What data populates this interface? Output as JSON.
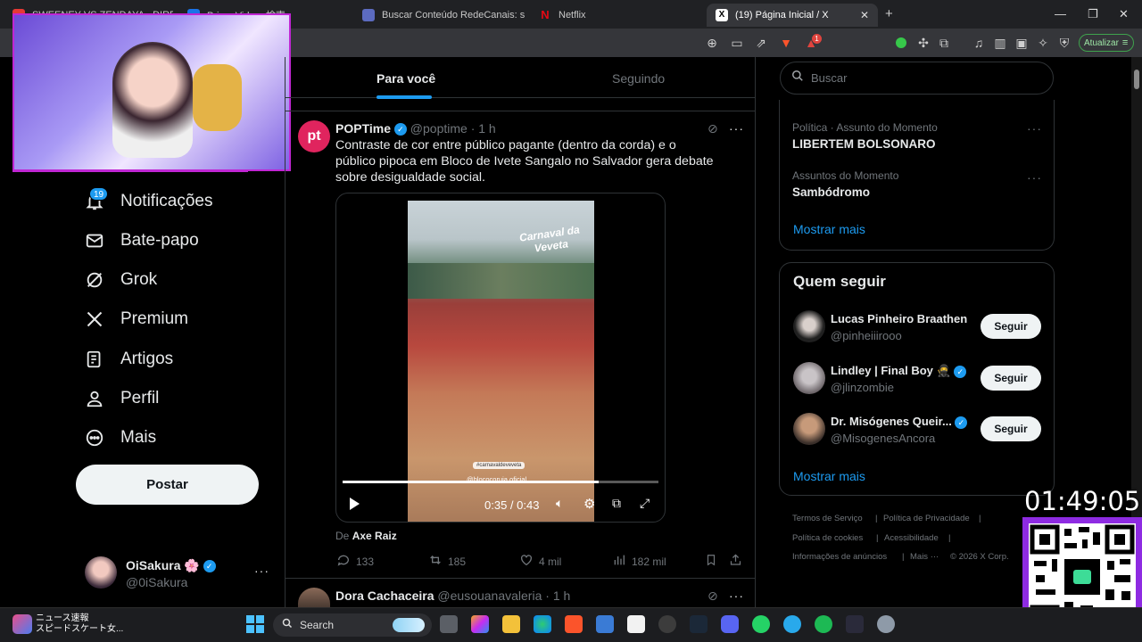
{
  "browser": {
    "tabs": [
      {
        "label": "SWEENEY VS ZENDAYA - DIREITA VS",
        "fav": "#e53935"
      },
      {
        "label": "Prime Video: 検索",
        "fav": "#1a73e8"
      },
      {
        "label": "Buscar Conteúdo RedeCanais: star tre",
        "fav": "#5c6bc0"
      },
      {
        "label": "Netflix",
        "fav": "#e50914"
      },
      {
        "label": "(19) Página Inicial / X",
        "fav": "#000000"
      }
    ],
    "update_label": "Atualizar",
    "new_tab": "+",
    "brave_badge": "1"
  },
  "nav": {
    "notifications_badge": "19",
    "items": [
      {
        "label": "Notificações",
        "icon": "bell-icon"
      },
      {
        "label": "Bate-papo",
        "icon": "mail-icon"
      },
      {
        "label": "Grok",
        "icon": "grok-icon"
      },
      {
        "label": "Premium",
        "icon": "x-logo-icon"
      },
      {
        "label": "Artigos",
        "icon": "article-icon"
      },
      {
        "label": "Perfil",
        "icon": "person-icon"
      },
      {
        "label": "Mais",
        "icon": "more-circle-icon"
      }
    ],
    "post_button": "Postar",
    "account": {
      "name": "OiSakura 🌸",
      "handle": "@0iSakura"
    }
  },
  "feed": {
    "tabs": {
      "for_you": "Para você",
      "following": "Seguindo"
    },
    "post": {
      "avatar_text": "pt",
      "author": "POPTime",
      "handle": "@poptime",
      "time": "· 1 h",
      "text": "Contraste de cor entre público pagante (dentro da corda) e o público pipoca em Bloco de Ivete Sangalo no Salvador gera debate sobre desigualdade social.",
      "video": {
        "watermark_title": "Carnaval da Veveta",
        "tag1": "#carnavaldeveveta",
        "tag2": "@blococoruja oficial",
        "time": "0:35 / 0:43",
        "progress": 0.81
      },
      "source_prefix": "De",
      "source": "Axe Raiz",
      "stats": {
        "replies": "133",
        "reposts": "185",
        "likes": "4 mil",
        "views": "182 mil"
      }
    },
    "next_post": {
      "author": "Dora Cachaceira",
      "handle": "@eusouanavaleria",
      "time": "· 1 h"
    }
  },
  "sidebar": {
    "search_placeholder": "Buscar",
    "trends": [
      {
        "meta": "Política · Assunto do Momento",
        "name": "LIBERTEM BOLSONARO"
      },
      {
        "meta": "Assuntos do Momento",
        "name": "Sambódromo"
      }
    ],
    "show_more": "Mostrar mais",
    "who_to_follow": {
      "title": "Quem seguir",
      "follow_label": "Seguir",
      "accounts": [
        {
          "name": "Lucas Pinheiro Braathen",
          "handle": "@pinheiiirooo",
          "verified": false
        },
        {
          "name": "Lindley | Final Boy 🥷",
          "handle": "@jlinzombie",
          "verified": true
        },
        {
          "name": "Dr. Misógenes Queir...",
          "handle": "@MisogenesAncora",
          "verified": true
        }
      ],
      "show_more": "Mostrar mais"
    },
    "footer": {
      "terms": "Termos de Serviço",
      "privacy": "Política de Privacidade",
      "cookies": "Política de cookies",
      "accessibility": "Acessibilidade",
      "ads": "Informações de anúncios",
      "more": "Mais ···",
      "copyright": "© 2026 X Corp."
    }
  },
  "overlay": {
    "clock": "01:49:05"
  },
  "taskbar": {
    "news_title": "ニュース速報",
    "news_sub": "スピードスケート女...",
    "search": "Search"
  }
}
